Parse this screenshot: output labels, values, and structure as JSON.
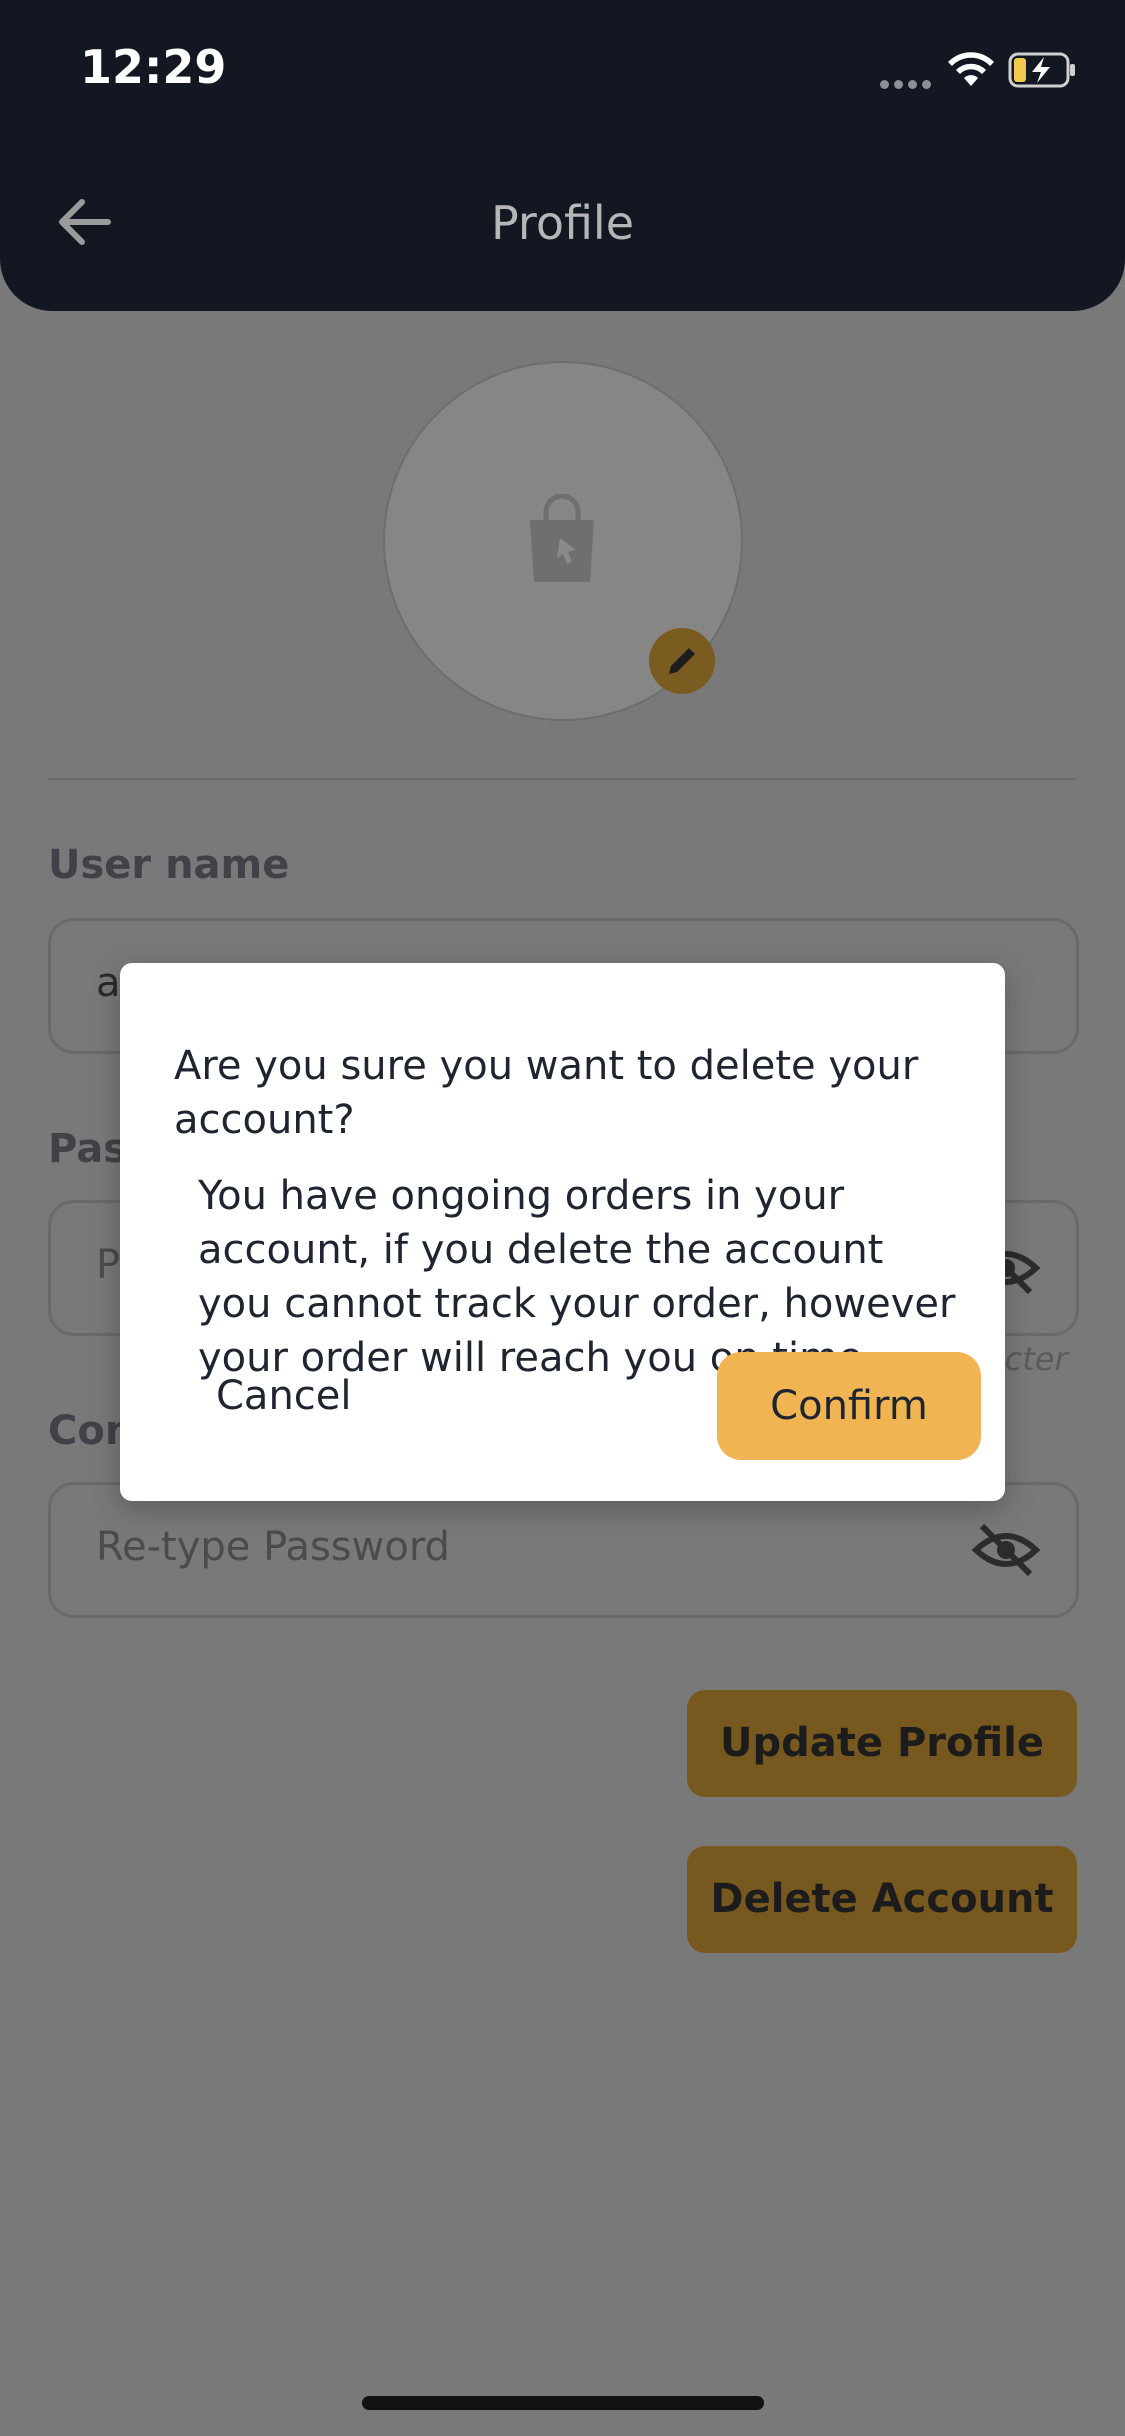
{
  "status_bar": {
    "time": "12:29"
  },
  "header": {
    "title": "Profile"
  },
  "form": {
    "username": {
      "label": "User name",
      "value": "a"
    },
    "password": {
      "label": "Pass",
      "placeholder": "P",
      "hint": "acter"
    },
    "confirm_password": {
      "label": "Con",
      "placeholder": "Re-type Password"
    }
  },
  "buttons": {
    "update": "Update Profile",
    "delete": "Delete Account"
  },
  "dialog": {
    "title": "Are you sure you want to delete your account?",
    "message": "You have ongoing orders in your account, if you delete the account you cannot track your order, however your order will reach you on time",
    "cancel": "Cancel",
    "confirm": "Confirm"
  },
  "colors": {
    "accent": "#f0b452",
    "header": "#121722",
    "overlay": "#797979"
  }
}
